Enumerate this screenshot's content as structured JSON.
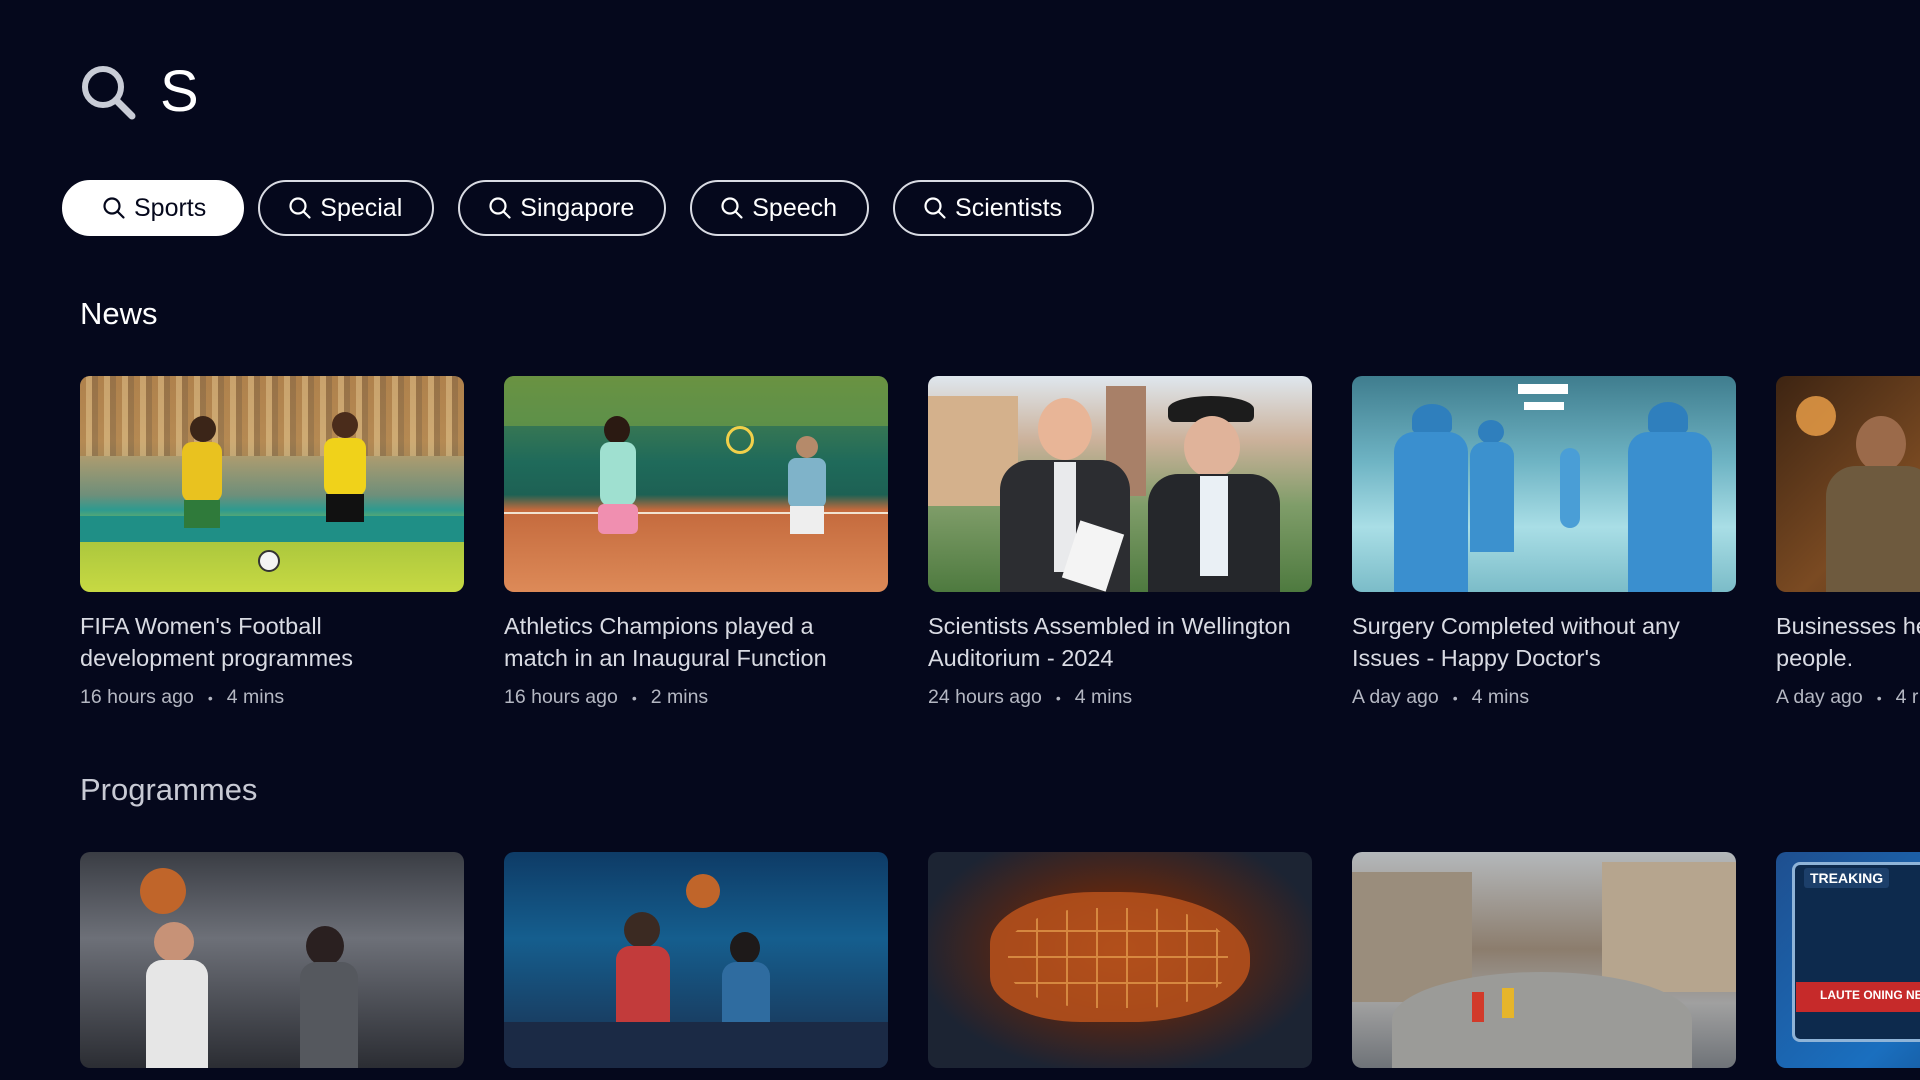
{
  "search": {
    "query": "S",
    "icon": "search-icon"
  },
  "chips": [
    {
      "label": "Sports",
      "active": true
    },
    {
      "label": "Special",
      "active": false
    },
    {
      "label": "Singapore",
      "active": false
    },
    {
      "label": "Speech",
      "active": false
    },
    {
      "label": "Scientists",
      "active": false
    }
  ],
  "news": {
    "title": "News",
    "cards": [
      {
        "title": "FIFA Women's Football\ndevelopment programmes",
        "time": "16 hours ago",
        "duration": "4 mins"
      },
      {
        "title": "Athletics Champions played a\nmatch in an Inaugural Function",
        "time": "16 hours ago",
        "duration": "2 mins"
      },
      {
        "title": "Scientists Assembled in Wellington\nAuditorium - 2024",
        "time": "24 hours ago",
        "duration": "4 mins"
      },
      {
        "title": "Surgery Completed without any\nIssues - Happy Doctor's",
        "time": "A day ago",
        "duration": "4 mins"
      },
      {
        "title": "Businesses he\npeople.",
        "time": "A day ago",
        "duration": "4 r"
      }
    ]
  },
  "programmes": {
    "title": "Programmes",
    "cards": [
      {
        "thumb_text": ""
      },
      {
        "thumb_text": ""
      },
      {
        "thumb_text": ""
      },
      {
        "thumb_text": ""
      },
      {
        "thumb_text_1": "TREAKING",
        "thumb_text_2": "LAUTE ONING NEWS"
      }
    ]
  },
  "colors": {
    "background": "#05081c",
    "chip_active_bg": "#ffffff",
    "text_primary": "#ffffff",
    "text_secondary": "#b4b7c2"
  }
}
